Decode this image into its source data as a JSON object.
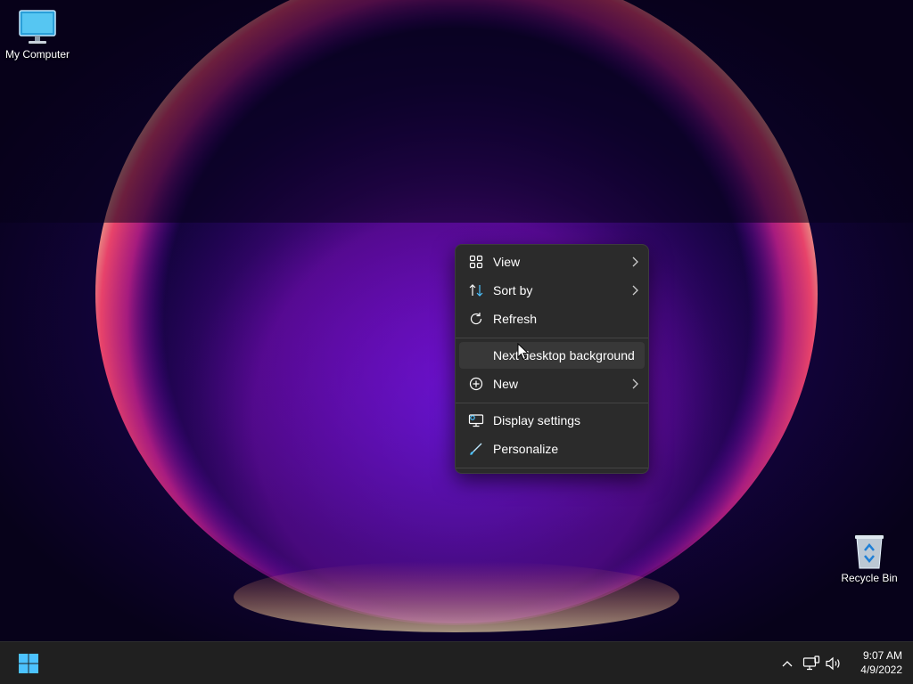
{
  "desktop": {
    "icons": [
      {
        "label": "My Computer",
        "icon": "monitor-icon"
      },
      {
        "label": "Recycle Bin",
        "icon": "recycle-bin-icon"
      }
    ]
  },
  "context_menu": {
    "items": [
      {
        "label": "View",
        "icon": "grid-icon",
        "submenu": true
      },
      {
        "label": "Sort by",
        "icon": "sort-icon",
        "submenu": true
      },
      {
        "label": "Refresh",
        "icon": "refresh-icon",
        "submenu": false
      },
      {
        "label": "Next desktop background",
        "icon": "",
        "submenu": false,
        "hovered": true
      },
      {
        "label": "New",
        "icon": "plus-circle-icon",
        "submenu": true
      },
      {
        "label": "Display settings",
        "icon": "display-settings-icon",
        "submenu": false
      },
      {
        "label": "Personalize",
        "icon": "brush-icon",
        "submenu": false
      }
    ]
  },
  "taskbar": {
    "start_icon": "windows-logo-icon",
    "tray_icons": [
      "chevron-up-icon",
      "network-icon",
      "volume-icon"
    ],
    "clock": {
      "time": "9:07 AM",
      "date": "4/9/2022"
    }
  },
  "colors": {
    "menu_bg": "#2b2b2b",
    "taskbar_bg": "#202020",
    "accent": "#4cc2ff"
  }
}
